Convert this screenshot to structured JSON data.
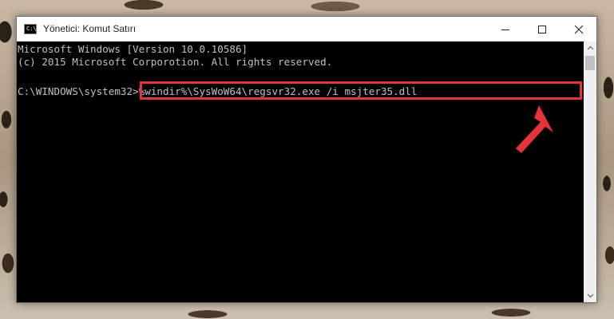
{
  "window": {
    "title": "Yönetici: Komut Satırı",
    "icon": "cmd-icon",
    "icon_glyph": "C:\\",
    "controls": {
      "minimize": "minimize-icon",
      "maximize": "maximize-icon",
      "close": "close-icon"
    }
  },
  "console": {
    "lines": [
      "Microsoft Windows [Version 10.0.10586]",
      "(c) 2015 Microsoft Corporotion. All rights reserved."
    ],
    "prompt": "C:\\WINDOWS\\system32>",
    "command": "%windir%\\SysWoW64\\regsvr32.exe /i msjter35.dll"
  },
  "annotation": {
    "highlight_color": "#e3343a",
    "arrow_color": "#e3343a"
  },
  "scrollbar": {
    "up": "chevron-up-icon",
    "down": "chevron-down-icon"
  }
}
